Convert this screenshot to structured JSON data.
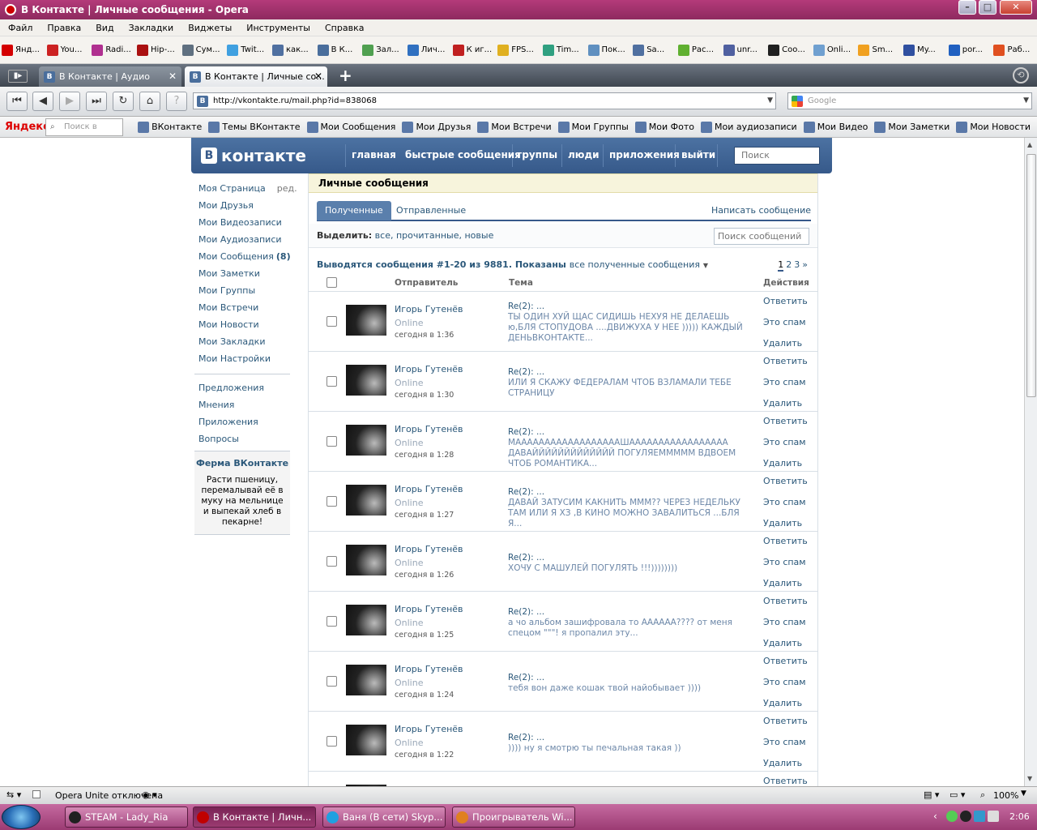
{
  "window": {
    "title": "В Контакте | Личные сообщения - Opera"
  },
  "menu": [
    "Файл",
    "Правка",
    "Вид",
    "Закладки",
    "Виджеты",
    "Инструменты",
    "Справка"
  ],
  "bookmarks": [
    {
      "label": "Янд...",
      "color": "#d40000"
    },
    {
      "label": "You...",
      "color": "#cc2222"
    },
    {
      "label": "Radi...",
      "color": "#b03090"
    },
    {
      "label": "Hip-...",
      "color": "#aa1010"
    },
    {
      "label": "Сум...",
      "color": "#607080"
    },
    {
      "label": "Twit...",
      "color": "#40a0e0"
    },
    {
      "label": "как...",
      "color": "#5070a0"
    },
    {
      "label": "В К...",
      "color": "#4a6e9c"
    },
    {
      "label": "Зал...",
      "color": "#50a050"
    },
    {
      "label": "Лич...",
      "color": "#3070c0"
    },
    {
      "label": "К иг...",
      "color": "#c02020"
    },
    {
      "label": "FPS...",
      "color": "#e0b020"
    },
    {
      "label": "Tim...",
      "color": "#30a080"
    },
    {
      "label": "Пок...",
      "color": "#6090c0"
    },
    {
      "label": "Sa...",
      "color": "#5070a0"
    },
    {
      "label": "Рас...",
      "color": "#60b030"
    },
    {
      "label": "unr...",
      "color": "#5060a0"
    },
    {
      "label": "Соо...",
      "color": "#202020"
    },
    {
      "label": "Onli...",
      "color": "#70a0d0"
    },
    {
      "label": "Sm...",
      "color": "#f0a020"
    },
    {
      "label": "My...",
      "color": "#3050a0"
    },
    {
      "label": "por...",
      "color": "#2060c0"
    },
    {
      "label": "Раб...",
      "color": "#e05020"
    }
  ],
  "tabs": [
    {
      "label": "В Контакте | Аудио",
      "active": false
    },
    {
      "label": "В Контакте | Личные со...",
      "active": true
    }
  ],
  "address": {
    "url": "http://vkontakte.ru/mail.php?id=838068",
    "search_placeholder": "Google"
  },
  "yandex_bar": {
    "logo": "Яндекс",
    "search_placeholder": "Поиск в Интернете",
    "links": [
      "ВКонтакте",
      "Темы ВКонтакте",
      "Мои Сообщения",
      "Мои Друзья",
      "Мои Встречи",
      "Мои Группы",
      "Мои Фото",
      "Мои аудиозаписи",
      "Мои Видео",
      "Мои Заметки",
      "Мои Новости"
    ]
  },
  "vk": {
    "logo": "контакте",
    "logo_b": "В",
    "nav": [
      "главная",
      "быстрые сообщения",
      "группы",
      "люди",
      "приложения",
      "выйти"
    ],
    "search_placeholder": "Поиск",
    "left_menu": [
      {
        "label": "Моя Страница",
        "extra": "ред."
      },
      {
        "label": "Мои Друзья"
      },
      {
        "label": "Мои Видеозаписи"
      },
      {
        "label": "Мои Аудиозаписи"
      },
      {
        "label": "Мои Сообщения",
        "count": "(8)"
      },
      {
        "label": "Мои Заметки"
      },
      {
        "label": "Мои Группы"
      },
      {
        "label": "Мои Встречи"
      },
      {
        "label": "Мои Новости"
      },
      {
        "label": "Мои Закладки"
      },
      {
        "label": "Мои Настройки"
      }
    ],
    "left_menu2": [
      "Предложения",
      "Мнения",
      "Приложения",
      "Вопросы"
    ],
    "farm": {
      "title": "Ферма ВКонтакте",
      "text": "Расти пшеницу, перемалывай её в муку на мельнице и выпекай хлеб в пекарне!"
    }
  },
  "mail": {
    "title": "Личные сообщения",
    "tab_received": "Полученные",
    "tab_sent": "Отправленные",
    "compose": "Написать сообщение",
    "select_label": "Выделить:",
    "select_options": "все, прочитанные, новые",
    "search_placeholder": "Поиск сообщений",
    "summary": "Выводятся сообщения #1-20 из 9881. Показаны",
    "summary_filter": "все полученные сообщения",
    "pages": [
      "1",
      "2",
      "3",
      "»"
    ],
    "columns": {
      "sender": "Отправитель",
      "subject": "Тема",
      "actions": "Действия"
    },
    "actions": [
      "Ответить",
      "Это спам",
      "Удалить"
    ],
    "messages": [
      {
        "sender": "Игорь Гутенёв",
        "status": "Online",
        "time": "сегодня в 1:36",
        "subject": "Re(2): ...",
        "preview": "ТЫ ОДИН ХУЙ ЩАС СИДИШЬ НЕХУЯ НЕ ДЕЛАЕШЬ ю,БЛЯ СТОПУДОВА ....ДВИЖУХА У НЕЕ ))))) КАЖДЫЙ ДЕНЬВКОНТАКТЕ..."
      },
      {
        "sender": "Игорь Гутенёв",
        "status": "Online",
        "time": "сегодня в 1:30",
        "subject": "Re(2): ...",
        "preview": "ИЛИ Я СКАЖУ ФЕДЕРАЛАМ ЧТОБ ВЗЛАМАЛИ ТЕБЕ СТРАНИЦУ"
      },
      {
        "sender": "Игорь Гутенёв",
        "status": "Online",
        "time": "сегодня в 1:28",
        "subject": "Re(2): ...",
        "preview": "МААААААААААААААААААШААААААААААААААААА ДАВАЙЙЙЙЙЙЙЙЙЙЙЙЙ ПОГУЛЯЕМММММ ВДВОЕМ ЧТОБ РОМАНТИКА..."
      },
      {
        "sender": "Игорь Гутенёв",
        "status": "Online",
        "time": "сегодня в 1:27",
        "subject": "Re(2): ...",
        "preview": "ДАВАЙ ЗАТУСИМ КАКНИТЬ МММ?? ЧЕРЕЗ НЕДЕЛЬКУ ТАМ ИЛИ Я ХЗ ,В КИНО МОЖНО ЗАВАЛИТЬСЯ ...БЛЯ Я..."
      },
      {
        "sender": "Игорь Гутенёв",
        "status": "Online",
        "time": "сегодня в 1:26",
        "subject": "Re(2): ...",
        "preview": "ХОЧУ С МАШУЛЕЙ ПОГУЛЯТЬ !!!))))))))"
      },
      {
        "sender": "Игорь Гутенёв",
        "status": "Online",
        "time": "сегодня в 1:25",
        "subject": "Re(2): ...",
        "preview": "а чо альбом зашифровала то АААААА???? от меня спецом \"\"\"! я пропалил эту..."
      },
      {
        "sender": "Игорь Гутенёв",
        "status": "Online",
        "time": "сегодня в 1:24",
        "subject": "Re(2): ...",
        "preview": "тебя вон даже кошак твой найобывает ))))"
      },
      {
        "sender": "Игорь Гутенёв",
        "status": "Online",
        "time": "сегодня в 1:22",
        "subject": "Re(2): ...",
        "preview": ")))) ну я смотрю ты печальная такая ))"
      }
    ],
    "partial_action": "Ответить"
  },
  "statusbar": {
    "unite": "Opera Unite отключена",
    "zoom": "100%"
  },
  "taskbar": {
    "items": [
      {
        "label": "STEAM - Lady_Ria",
        "color": "#202020"
      },
      {
        "label": "В Контакте | Личн...",
        "color": "#c00000"
      },
      {
        "label": "Ваня (В сети) Skyp...",
        "color": "#20a0e0"
      },
      {
        "label": "Проигрыватель Wi...",
        "color": "#e08020"
      }
    ],
    "clock": "2:06"
  }
}
